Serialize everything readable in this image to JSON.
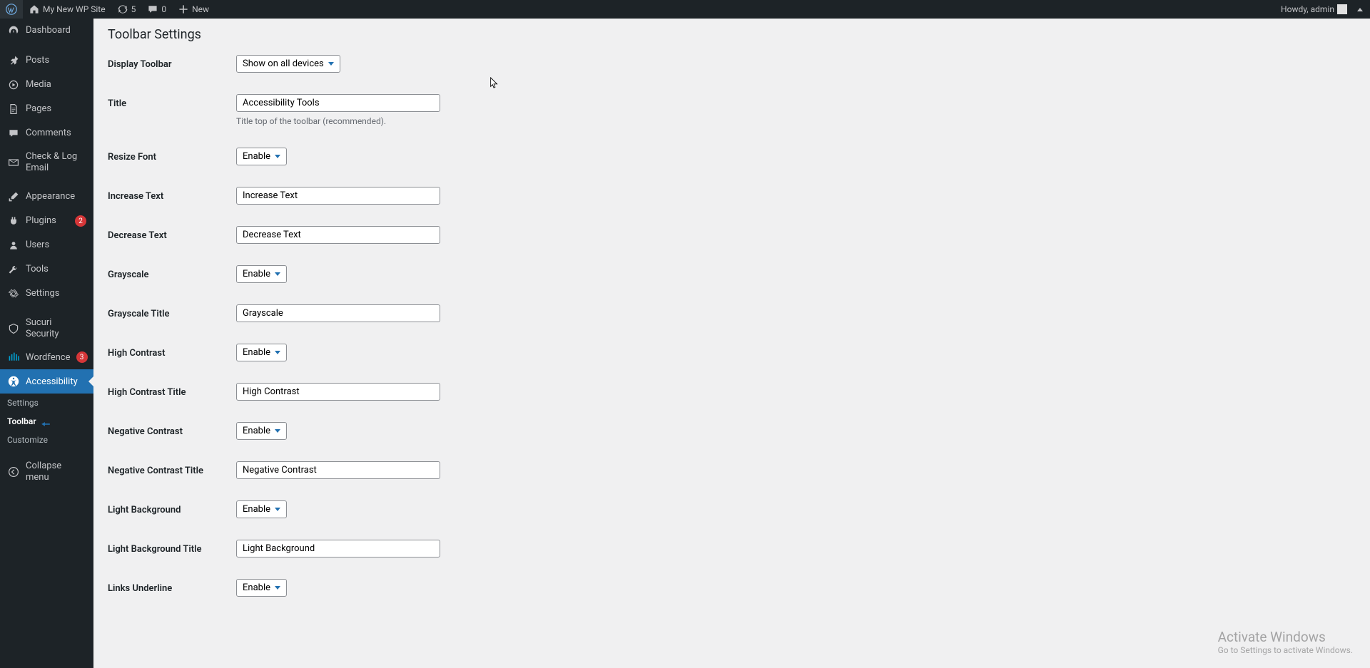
{
  "topbar": {
    "site_name": "My New WP Site",
    "refresh_count": "5",
    "comments_count": "0",
    "new_label": "New",
    "greeting": "Howdy, admin"
  },
  "sidebar": {
    "items": [
      {
        "icon": "dashboard",
        "label": "Dashboard"
      },
      {
        "icon": "pin",
        "label": "Posts"
      },
      {
        "icon": "media",
        "label": "Media"
      },
      {
        "icon": "page",
        "label": "Pages"
      },
      {
        "icon": "comment",
        "label": "Comments"
      },
      {
        "icon": "mail",
        "label": "Check & Log Email"
      },
      {
        "icon": "brush",
        "label": "Appearance"
      },
      {
        "icon": "plug",
        "label": "Plugins",
        "badge": "2"
      },
      {
        "icon": "user",
        "label": "Users"
      },
      {
        "icon": "wrench",
        "label": "Tools"
      },
      {
        "icon": "gear",
        "label": "Settings"
      },
      {
        "icon": "shield",
        "label": "Sucuri Security"
      },
      {
        "icon": "wf",
        "label": "Wordfence",
        "badge": "3"
      },
      {
        "icon": "accessibility",
        "label": "Accessibility",
        "active": true
      }
    ],
    "submenu": [
      {
        "label": "Settings"
      },
      {
        "label": "Toolbar",
        "active": true
      },
      {
        "label": "Customize"
      }
    ],
    "collapse_label": "Collapse menu"
  },
  "page": {
    "title": "Toolbar Settings",
    "rows": {
      "display_toolbar": {
        "label": "Display Toolbar",
        "value": "Show on all devices",
        "type": "select"
      },
      "title": {
        "label": "Title",
        "value": "Accessibility Tools",
        "type": "text",
        "help": "Title top of the toolbar (recommended)."
      },
      "resize_font": {
        "label": "Resize Font",
        "value": "Enable",
        "type": "select"
      },
      "increase_text": {
        "label": "Increase Text",
        "value": "Increase Text",
        "type": "text"
      },
      "decrease_text": {
        "label": "Decrease Text",
        "value": "Decrease Text",
        "type": "text"
      },
      "grayscale": {
        "label": "Grayscale",
        "value": "Enable",
        "type": "select"
      },
      "grayscale_title": {
        "label": "Grayscale Title",
        "value": "Grayscale",
        "type": "text"
      },
      "high_contrast": {
        "label": "High Contrast",
        "value": "Enable",
        "type": "select"
      },
      "high_contrast_title": {
        "label": "High Contrast Title",
        "value": "High Contrast",
        "type": "text"
      },
      "negative_contrast": {
        "label": "Negative Contrast",
        "value": "Enable",
        "type": "select"
      },
      "negative_contrast_title": {
        "label": "Negative Contrast Title",
        "value": "Negative Contrast",
        "type": "text"
      },
      "light_background": {
        "label": "Light Background",
        "value": "Enable",
        "type": "select"
      },
      "light_background_title": {
        "label": "Light Background Title",
        "value": "Light Background",
        "type": "text"
      },
      "links_underline": {
        "label": "Links Underline",
        "value": "Enable",
        "type": "select"
      }
    }
  },
  "watermark": {
    "title": "Activate Windows",
    "sub": "Go to Settings to activate Windows."
  }
}
